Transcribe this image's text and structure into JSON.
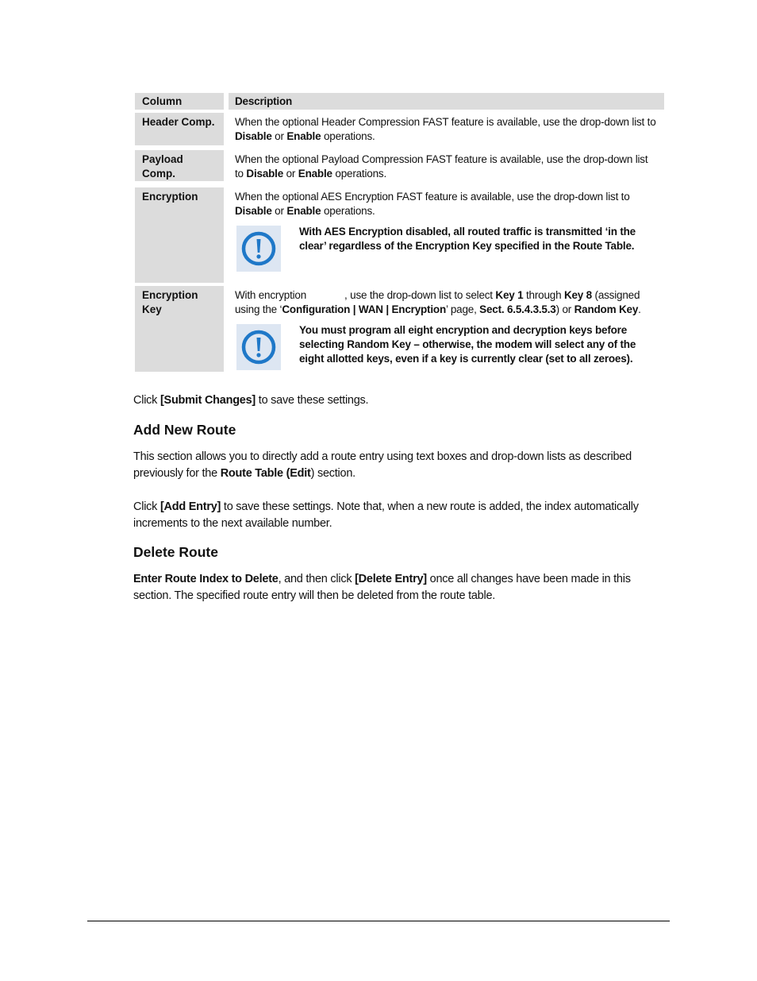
{
  "table": {
    "header": {
      "column": "Column",
      "description": "Description"
    },
    "rows": [
      {
        "column": "Header Comp.",
        "desc_pre": "When the optional Header Compression FAST feature is available, use the drop-down list to ",
        "bold1": "Disable",
        "mid": " or ",
        "bold2": "Enable",
        "post": " operations."
      },
      {
        "column": "Payload Comp.",
        "desc_pre": "When the optional Payload Compression FAST feature is available, use the drop-down list to ",
        "bold1": "Disable",
        "mid": " or ",
        "bold2": "Enable",
        "post": " operations."
      },
      {
        "column": "Encryption",
        "desc_pre": "When the optional AES Encryption FAST feature is available, use the drop-down list to ",
        "bold1": "Disable",
        "mid": " or ",
        "bold2": "Enable",
        "post": " operations.",
        "note": "With AES Encryption disabled, all routed traffic is transmitted ‘in the clear’ regardless of the Encryption Key specified in the Route Table."
      },
      {
        "column_line1": "Encryption",
        "column_line2": "Key",
        "p1": "With encryption",
        "p2": ", use the drop-down list to select ",
        "key1": "Key 1",
        "p3": " through ",
        "key8": "Key 8",
        "p4": " (assigned using the ‘",
        "page": "Configuration | WAN | Encryption",
        "p5": "’ page, ",
        "sect": "Sect. 6.5.4.3.5.3",
        "p6": ") or ",
        "random": "Random Key",
        "p7": ".",
        "note": "You must program all eight encryption and decryption keys before selecting Random Key – otherwise, the modem will select any of the eight allotted keys, even if a key is currently clear (set to all zeroes)."
      }
    ]
  },
  "submit": {
    "pre": "Click ",
    "bold": "[Submit Changes]",
    "post": " to save these settings."
  },
  "add_route": {
    "heading": "Add New Route",
    "p1_pre": "This section allows you to directly add a route entry using text boxes and drop-down lists as described previously for the ",
    "p1_bold": "Route Table (Edit",
    "p1_post": ") section.",
    "p2_pre": "Click ",
    "p2_bold": "[Add Entry]",
    "p2_post": " to save these settings. Note that, when a new route is added, the index automatically increments to the next available number."
  },
  "delete_route": {
    "heading": "Delete Route",
    "bold1": "Enter Route Index to Delete",
    "mid": ", and then click ",
    "bold2": "[Delete Entry]",
    "post": " once all changes have been made in this section. The specified route entry will then be deleted from the route table."
  },
  "colors": {
    "icon_blue": "#1f78c8",
    "icon_bg": "#dde6f2",
    "cell_gray": "#dcdcdc"
  }
}
